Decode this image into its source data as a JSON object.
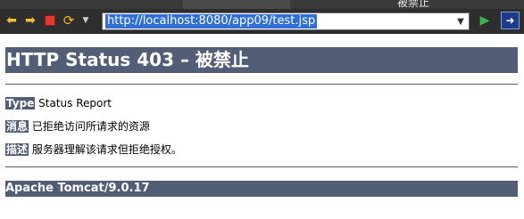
{
  "browser": {
    "tab_title": "被禁止",
    "url": "http://localhost:8080/app09/test.jsp",
    "icons": {
      "back": "arrow-left-icon",
      "forward": "arrow-right-icon",
      "stop": "stop-icon",
      "refresh": "refresh-icon",
      "history_dropdown": "chevron-down-icon",
      "url_dropdown": "chevron-down-icon",
      "go": "play-icon",
      "external": "open-external-icon"
    }
  },
  "page": {
    "heading": "HTTP Status 403 – 被禁止",
    "type_label": "Type",
    "type_value": "Status Report",
    "message_label": "消息",
    "message_value": "已拒绝访问所请求的资源",
    "description_label": "描述",
    "description_value": "服务器理解该请求但拒绝授权。",
    "footer": "Apache Tomcat/9.0.17"
  },
  "colors": {
    "banner": "#525d76",
    "url_highlight": "#2f6fd6",
    "toolbar": "#2e2e2e"
  }
}
